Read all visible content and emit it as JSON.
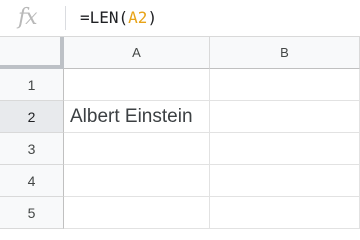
{
  "formula_bar": {
    "fx_label": "fx",
    "formula_prefix": "=LEN(",
    "formula_ref": "A2",
    "formula_suffix": ")"
  },
  "columns": [
    "A",
    "B"
  ],
  "rows": [
    "1",
    "2",
    "3",
    "4",
    "5"
  ],
  "cells": {
    "A1": "",
    "B1": "",
    "A2": "Albert Einstein",
    "B2": "",
    "A3": "",
    "B3": "",
    "A4": "",
    "B4": "",
    "A5": "",
    "B5": ""
  },
  "colors": {
    "reference_highlight": "#e8a317",
    "header_bg": "#f8f9fa",
    "active_row_header_bg": "#e8eaed"
  }
}
